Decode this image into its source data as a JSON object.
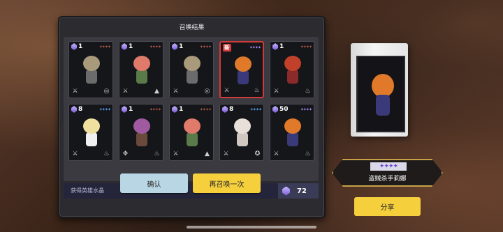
{
  "panel": {
    "title": "召唤结果",
    "crystal_label": "获得英雄水晶",
    "crystal_value": "72",
    "confirm_label": "确认",
    "again_label": "再召唤一次"
  },
  "cards": [
    {
      "count": "1",
      "new": "",
      "stars": "✦✦✦✦",
      "star_color": "red",
      "hair": "#a89a7a",
      "outfit": "#6b6b6b",
      "roles": [
        "⚔",
        "◎"
      ]
    },
    {
      "count": "1",
      "new": "",
      "stars": "✦✦✦✦",
      "star_color": "red",
      "hair": "#e07a6a",
      "outfit": "#5a7a4a",
      "roles": [
        "⚔",
        "▲"
      ]
    },
    {
      "count": "1",
      "new": "",
      "stars": "✦✦✦✦",
      "star_color": "red",
      "hair": "#a89a7a",
      "outfit": "#6b6b6b",
      "roles": [
        "⚔",
        "◎"
      ]
    },
    {
      "count": "",
      "new": "新",
      "stars": "✦✦✦✦",
      "star_color": "purple",
      "hair": "#e07a2a",
      "outfit": "#3a3a7a",
      "roles": [
        "⚔",
        "♨"
      ]
    },
    {
      "count": "1",
      "new": "",
      "stars": "✦✦✦✦",
      "star_color": "red",
      "hair": "#c0402a",
      "outfit": "#8a2a2a",
      "roles": [
        "⚔",
        "♨"
      ]
    },
    {
      "count": "8",
      "new": "",
      "stars": "✦✦✦✦",
      "star_color": "blue",
      "hair": "#f0e0a0",
      "outfit": "#f0f0f0",
      "roles": [
        "⚔",
        "♨"
      ]
    },
    {
      "count": "1",
      "new": "",
      "stars": "✦✦✦✦",
      "star_color": "red",
      "hair": "#a05aa0",
      "outfit": "#6a4a3a",
      "roles": [
        "✥",
        "♨"
      ]
    },
    {
      "count": "1",
      "new": "",
      "stars": "✦✦✦✦",
      "star_color": "red",
      "hair": "#e07a6a",
      "outfit": "#5a7a4a",
      "roles": [
        "⚔",
        "▲"
      ]
    },
    {
      "count": "8",
      "new": "",
      "stars": "✦✦✦✦",
      "star_color": "blue",
      "hair": "#e8e0d8",
      "outfit": "#d0c8c0",
      "roles": [
        "⚔",
        "✪"
      ]
    },
    {
      "count": "50",
      "new": "",
      "stars": "✦✦✦✦",
      "star_color": "purple",
      "hair": "#e07a2a",
      "outfit": "#3a3a7a",
      "roles": [
        "⚔",
        "♨"
      ]
    }
  ],
  "featured": {
    "stars": "✦✦✦✦",
    "name": "盗贼杀手莉娜",
    "hair": "#e07a2a",
    "outfit": "#3a3a7a",
    "share_label": "分享"
  }
}
